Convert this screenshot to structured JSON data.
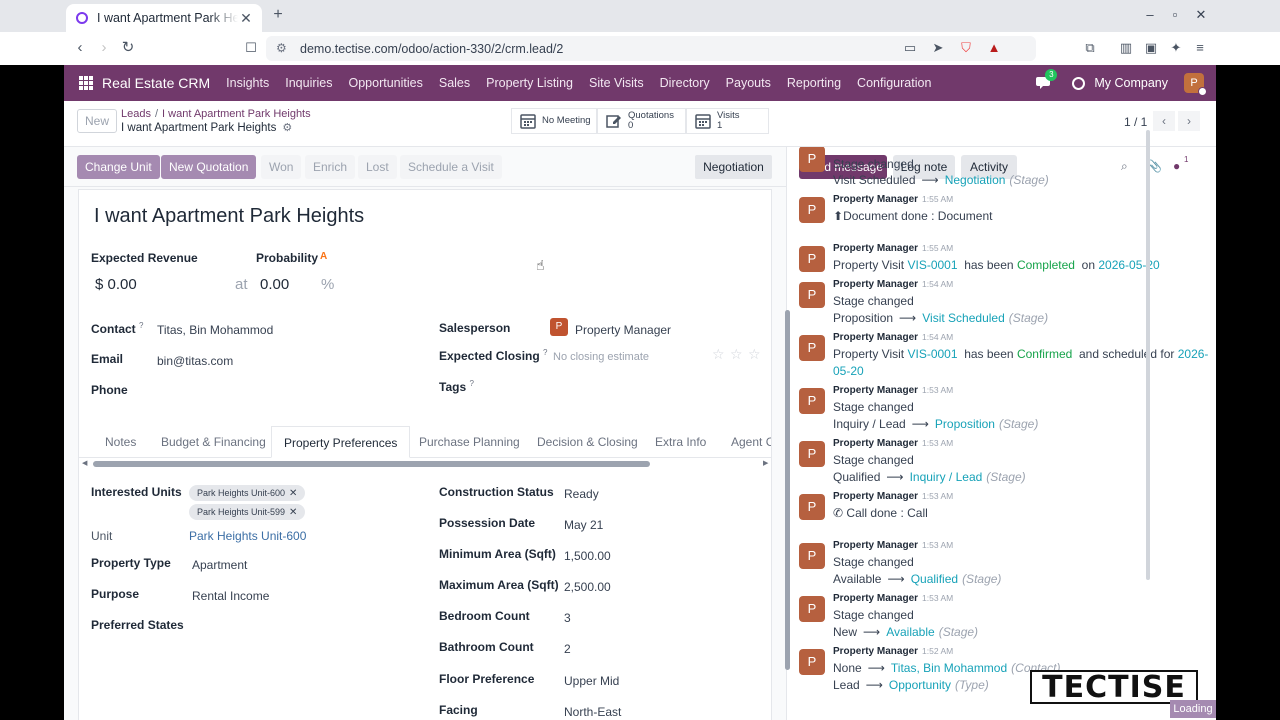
{
  "browser": {
    "tab_title": "I want Apartment Park Heights",
    "url": "demo.tectise.com/odoo/action-330/2/crm.lead/2"
  },
  "navbar": {
    "brand": "Real Estate CRM",
    "menu": [
      "Insights",
      "Inquiries",
      "Opportunities",
      "Sales",
      "Property Listing",
      "Site Visits",
      "Directory",
      "Payouts",
      "Reporting",
      "Configuration"
    ],
    "chat_badge": "3",
    "company": "My Company",
    "avatar_letter": "P"
  },
  "control_panel": {
    "new_label": "New",
    "breadcrumb_parent": "Leads",
    "breadcrumb_sep": "/",
    "breadcrumb_middle": "I want Apartment Park Heights",
    "breadcrumb_current": "I want Apartment Park Heights",
    "meeting_label": "No Meeting",
    "quotations_label": "Quotations",
    "quotations_count": "0",
    "visits_label": "Visits",
    "visits_count": "1",
    "pager": "1 / 1"
  },
  "statusbar": {
    "buttons": [
      "Change Unit",
      "New Quotation",
      "Won",
      "Enrich",
      "Lost",
      "Schedule a Visit"
    ],
    "current_stage": "Negotiation"
  },
  "form": {
    "title": "I want Apartment Park Heights",
    "expected_revenue_label": "Expected Revenue",
    "expected_revenue": "$ 0.00",
    "at_label": "at",
    "probability_label": "Probability",
    "probability": "0.00",
    "percent": "%",
    "contact_label": "Contact",
    "contact": "Titas, Bin Mohammod",
    "email_label": "Email",
    "email": "bin@titas.com",
    "phone_label": "Phone",
    "salesperson_label": "Salesperson",
    "salesperson": "Property Manager",
    "salesperson_letter": "P",
    "expected_closing_label": "Expected Closing",
    "expected_closing_placeholder": "No closing estimate",
    "tags_label": "Tags",
    "help_mark": "?"
  },
  "tabs": [
    "Notes",
    "Budget & Financing",
    "Property Preferences",
    "Purchase Planning",
    "Decision & Closing",
    "Extra Info",
    "Agent Co"
  ],
  "preferences": {
    "interested_units_label": "Interested Units",
    "interested_units": [
      "Park Heights Unit-600",
      "Park Heights Unit-599"
    ],
    "unit_label": "Unit",
    "unit": "Park Heights Unit-600",
    "property_type_label": "Property Type",
    "property_type": "Apartment",
    "purpose_label": "Purpose",
    "purpose": "Rental Income",
    "preferred_states_label": "Preferred States",
    "construction_status_label": "Construction Status",
    "construction_status": "Ready",
    "possession_date_label": "Possession Date",
    "possession_date": "May 21",
    "min_area_label": "Minimum Area (Sqft)",
    "min_area": "1,500.00",
    "max_area_label": "Maximum Area (Sqft)",
    "max_area": "2,500.00",
    "bedroom_label": "Bedroom Count",
    "bedroom": "3",
    "bathroom_label": "Bathroom Count",
    "bathroom": "2",
    "floor_label": "Floor Preference",
    "floor": "Upper Mid",
    "facing_label": "Facing",
    "facing": "North-East"
  },
  "chatter": {
    "send_message": "Send message",
    "log_note": "Log note",
    "activity": "Activity",
    "followers": "1",
    "author": "Property Manager",
    "avatar": "P",
    "stage_changed": "Stage changed",
    "stage_tag": "(Stage)",
    "contact_tag": "(Contact)",
    "type_tag": "(Type)",
    "messages": [
      {
        "from": "Visit Scheduled",
        "to": "Negotiation"
      },
      {
        "time": "1:55 AM",
        "text": "Document done : Document"
      },
      {
        "time": "1:55 AM",
        "pre": "Property Visit",
        "ref": "VIS-0001",
        "mid": "has been",
        "status": "Completed",
        "post": "on",
        "date": "2026-05-20"
      },
      {
        "time": "1:54 AM",
        "from": "Proposition",
        "to": "Visit Scheduled"
      },
      {
        "time": "1:54 AM",
        "pre": "Property Visit",
        "ref": "VIS-0001",
        "mid": "has been",
        "status": "Confirmed",
        "post": "and scheduled for",
        "date1": "2026-",
        "date2": "05-20"
      },
      {
        "time": "1:53 AM",
        "from": "Inquiry / Lead",
        "to": "Proposition"
      },
      {
        "time": "1:53 AM",
        "from": "Qualified",
        "to": "Inquiry / Lead"
      },
      {
        "time": "1:53 AM",
        "text": "Call done : Call"
      },
      {
        "time": "1:53 AM",
        "from": "Available",
        "to": "Qualified"
      },
      {
        "time": "1:53 AM",
        "from": "New",
        "to": "Available"
      },
      {
        "time": "1:52 AM",
        "from": "None",
        "to": "Titas, Bin Mohammod"
      },
      {
        "from": "Lead",
        "to": "Opportunity"
      }
    ]
  },
  "overlay": {
    "logo": "TECTISE",
    "loading": "Loading"
  },
  "colors": {
    "navbar": "#71396b",
    "primary_soft": "#a58ab1",
    "link": "#17a2b8",
    "success": "#16a34a",
    "avatar": "#b6603f"
  }
}
